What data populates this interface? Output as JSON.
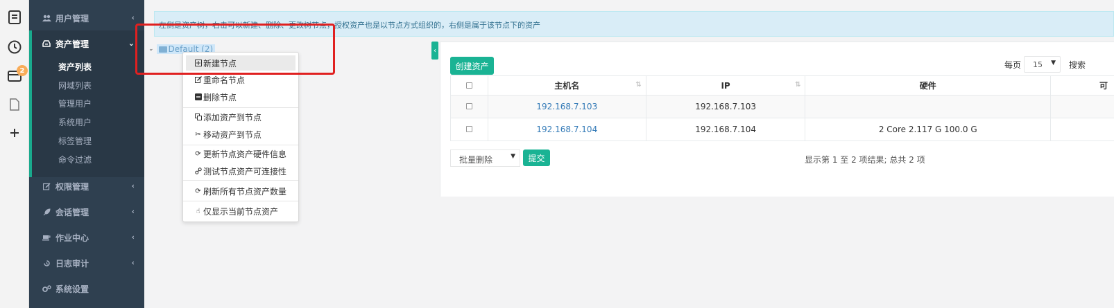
{
  "rail": {
    "badge_count": "2"
  },
  "sidebar": {
    "items": [
      {
        "label": "用户管理",
        "icon": "users-icon"
      },
      {
        "label": "资产管理",
        "icon": "inbox-icon"
      },
      {
        "label": "权限管理",
        "icon": "edit-icon"
      },
      {
        "label": "会话管理",
        "icon": "rocket-icon"
      },
      {
        "label": "作业中心",
        "icon": "coffee-icon"
      },
      {
        "label": "日志审计",
        "icon": "history-icon"
      },
      {
        "label": "系统设置",
        "icon": "gears-icon"
      }
    ],
    "subitems": [
      "资产列表",
      "网域列表",
      "管理用户",
      "系统用户",
      "标签管理",
      "命令过滤"
    ]
  },
  "info": {
    "text": "左侧是资产树，右击可以新建、删除、更改树节点，授权资产也是以节点方式组织的，右侧是属于该节点下的资产"
  },
  "tree": {
    "root": "Default (2)"
  },
  "context_menu": {
    "items": [
      {
        "label": "新建节点",
        "icon": "plus-square-icon"
      },
      {
        "label": "重命名节点",
        "icon": "edit-icon"
      },
      {
        "label": "删除节点",
        "icon": "minus-square-icon"
      },
      {
        "label": "添加资产到节点",
        "icon": "copy-icon"
      },
      {
        "label": "移动资产到节点",
        "icon": "scissors-icon"
      },
      {
        "label": "更新节点资产硬件信息",
        "icon": "refresh-icon"
      },
      {
        "label": "测试节点资产可连接性",
        "icon": "link-icon"
      },
      {
        "label": "刷新所有节点资产数量",
        "icon": "refresh-icon"
      },
      {
        "label": "仅显示当前节点资产",
        "icon": "hand-pointer-icon"
      }
    ]
  },
  "toolbar": {
    "create_label": "创建资产",
    "per_page_label": "每页",
    "per_page_value": "15",
    "search_label": "搜索"
  },
  "table": {
    "columns": [
      "主机名",
      "IP",
      "硬件",
      "可"
    ],
    "rows": [
      {
        "hostname": "192.168.7.103",
        "ip": "192.168.7.103",
        "hardware": ""
      },
      {
        "hostname": "192.168.7.104",
        "ip": "192.168.7.104",
        "hardware": "2 Core 2.117 G 100.0 G"
      }
    ]
  },
  "footer": {
    "batch_label": "批量删除",
    "submit_label": "提交",
    "pager_text": "显示第 1 至 2 项结果; 总共 2 项"
  },
  "colors": {
    "accent": "#1ab394",
    "sidebar_bg": "#2f4050",
    "highlight": "#e02020"
  }
}
